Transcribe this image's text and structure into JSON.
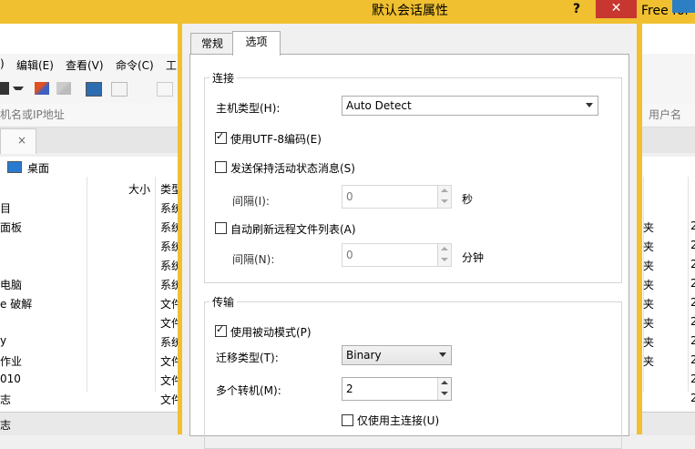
{
  "background_app": {
    "title_fragment": "Free for",
    "menu": [
      "编辑(E)",
      "查看(V)",
      "命令(C)",
      "工"
    ],
    "menu_prefix": ")",
    "address_placeholder": "机名或IP地址",
    "username_label": "用户名",
    "path": "桌面",
    "columns": {
      "size": "大小",
      "type": "类型"
    },
    "rows": [
      {
        "name": "目",
        "type": "系统"
      },
      {
        "name": "面板",
        "type": "系统"
      },
      {
        "name": "",
        "type": "系统"
      },
      {
        "name": "",
        "type": "系统"
      },
      {
        "name": "电脑",
        "type": "系统"
      },
      {
        "name": "e 破解",
        "type": "文件"
      },
      {
        "name": "",
        "type": "文件"
      },
      {
        "name": "y",
        "type": "系统"
      },
      {
        "name": "作业",
        "type": "文件"
      },
      {
        "name": "010",
        "type": "文件"
      },
      {
        "name": "志",
        "type": "文件"
      }
    ],
    "right_rows": [
      "夹",
      "夹",
      "夹",
      "夹",
      "夹",
      "夹",
      "夹",
      "夹"
    ],
    "right_col2": [
      "2",
      "2",
      "2",
      "2",
      "2",
      "2",
      "2",
      "2",
      "2",
      "2"
    ],
    "status_text": "志"
  },
  "dialog": {
    "title": "默认会话属性",
    "help": "?",
    "close": "✕",
    "tabs": [
      "常规",
      "选项"
    ],
    "active_tab": 1,
    "connection": {
      "group_label": "连接",
      "host_type_label": "主机类型(H):",
      "host_type_value": "Auto Detect",
      "utf8_label": "使用UTF-8编码(E)",
      "utf8_checked": true,
      "keepalive_label": "发送保持活动状态消息(S)",
      "keepalive_checked": false,
      "interval_label": "间隔(I):",
      "interval_value": "0",
      "interval_unit": "秒",
      "autorefresh_label": "自动刷新远程文件列表(A)",
      "autorefresh_checked": false,
      "refresh_interval_label": "间隔(N):",
      "refresh_interval_value": "0",
      "refresh_interval_unit": "分钟"
    },
    "transfer": {
      "group_label": "传输",
      "passive_label": "使用被动模式(P)",
      "passive_checked": true,
      "transfer_type_label": "迁移类型(T):",
      "transfer_type_value": "Binary",
      "multi_label": "多个转机(M):",
      "multi_value": "2",
      "primary_only_label": "仅使用主连接(U)",
      "primary_only_checked": false
    }
  }
}
